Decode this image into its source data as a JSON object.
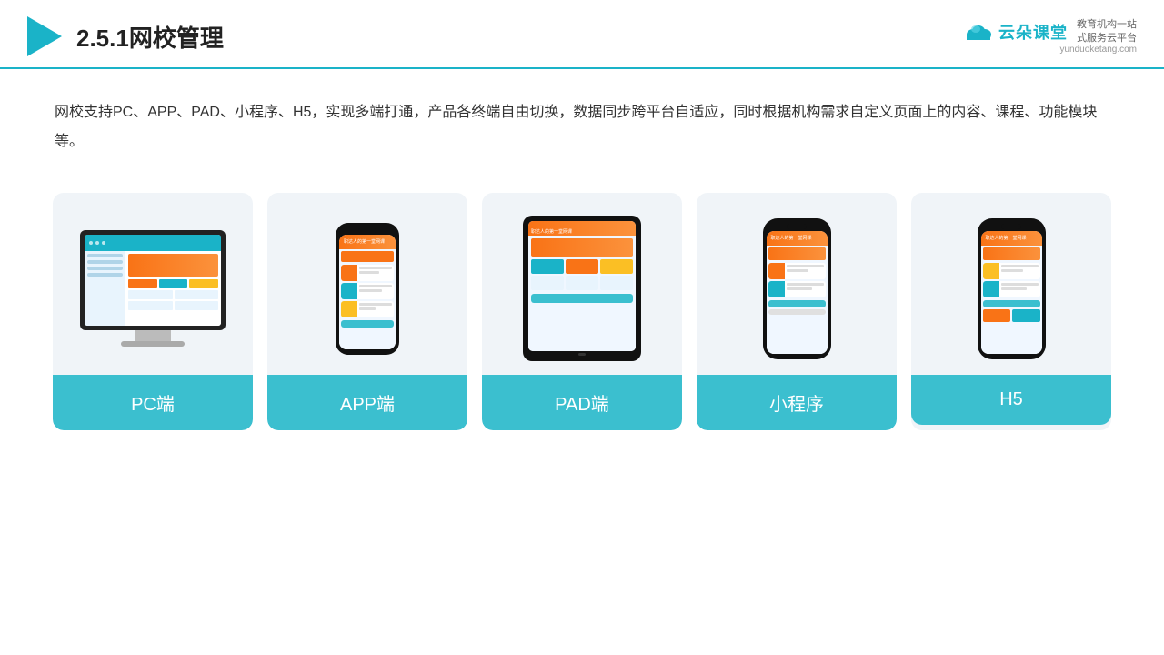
{
  "header": {
    "title": "2.5.1网校管理",
    "logo": {
      "main": "云朵课堂",
      "url": "yunduoketang.com",
      "tagline": "教育机构一站\n式服务云平台"
    }
  },
  "description": {
    "text": "网校支持PC、APP、PAD、小程序、H5，实现多端打通，产品各终端自由切换，数据同步跨平台自适应，同时根据机构需求自定义页面上的内容、课程、功能模块等。"
  },
  "cards": [
    {
      "id": "pc",
      "label": "PC端"
    },
    {
      "id": "app",
      "label": "APP端"
    },
    {
      "id": "pad",
      "label": "PAD端"
    },
    {
      "id": "miniapp",
      "label": "小程序"
    },
    {
      "id": "h5",
      "label": "H5"
    }
  ]
}
